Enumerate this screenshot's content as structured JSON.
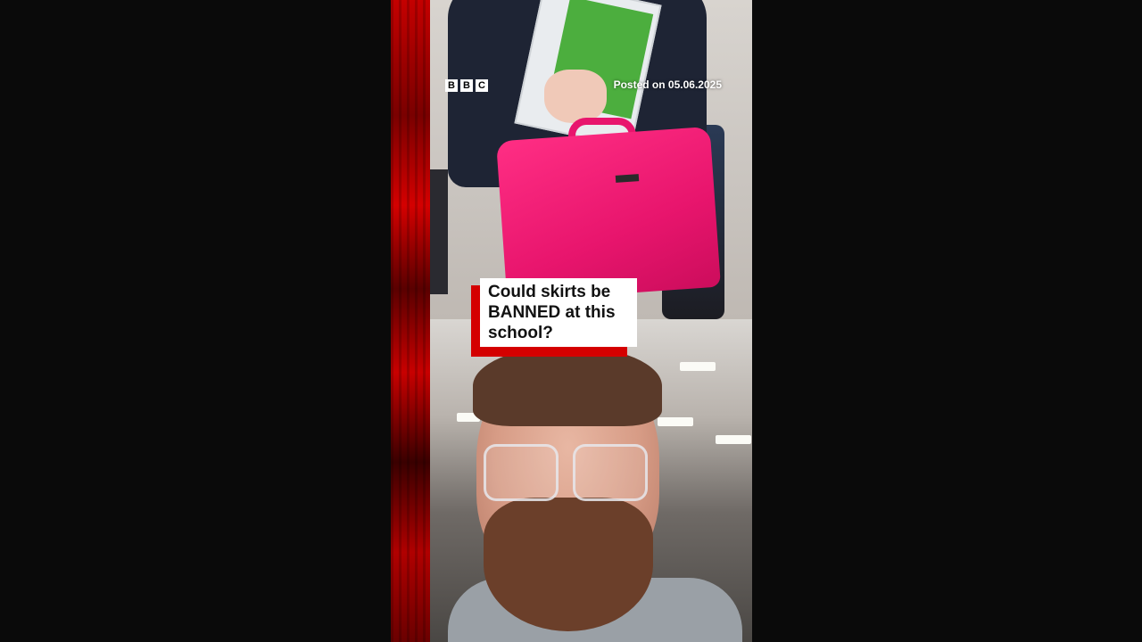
{
  "player": {
    "brand_logo_letters": [
      "B",
      "B",
      "C"
    ],
    "posted_text": "Posted on 05.06.2025",
    "headline": "Could skirts be\nBANNED at this\nschool?",
    "colors": {
      "accent_red": "#d40000",
      "background": "#0a0a0a",
      "headline_bg": "#ffffff",
      "headline_text": "#111111"
    }
  }
}
